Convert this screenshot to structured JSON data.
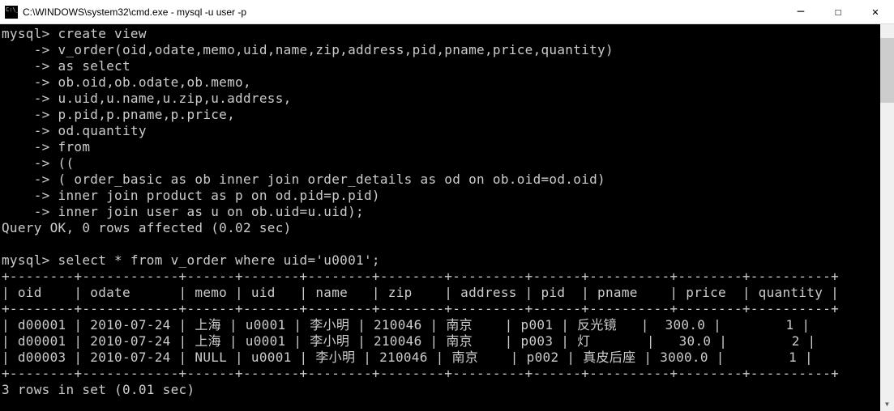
{
  "window": {
    "title": "C:\\WINDOWS\\system32\\cmd.exe - mysql  -u user -p"
  },
  "terminal": {
    "lines": [
      "mysql> create view",
      "    -> v_order(oid,odate,memo,uid,name,zip,address,pid,pname,price,quantity)",
      "    -> as select",
      "    -> ob.oid,ob.odate,ob.memo,",
      "    -> u.uid,u.name,u.zip,u.address,",
      "    -> p.pid,p.pname,p.price,",
      "    -> od.quantity",
      "    -> from",
      "    -> ((",
      "    -> ( order_basic as ob inner join order_details as od on ob.oid=od.oid)",
      "    -> inner join product as p on od.pid=p.pid)",
      "    -> inner join user as u on ob.uid=u.uid);",
      "Query OK, 0 rows affected (0.02 sec)",
      "",
      "mysql> select * from v_order where uid='u0001';",
      "+--------+------------+------+-------+--------+--------+---------+------+----------+--------+----------+",
      "| oid    | odate      | memo | uid   | name   | zip    | address | pid  | pname    | price  | quantity |",
      "+--------+------------+------+-------+--------+--------+---------+------+----------+--------+----------+",
      "| d00001 | 2010-07-24 | 上海 | u0001 | 李小明 | 210046 | 南京    | p001 | 反光镜   |  300.0 |        1 |",
      "| d00001 | 2010-07-24 | 上海 | u0001 | 李小明 | 210046 | 南京    | p003 | 灯       |   30.0 |        2 |",
      "| d00003 | 2010-07-24 | NULL | u0001 | 李小明 | 210046 | 南京    | p002 | 真皮后座 | 3000.0 |        1 |",
      "+--------+------------+------+-------+--------+--------+---------+------+----------+--------+----------+",
      "3 rows in set (0.01 sec)"
    ]
  },
  "chart_data": {
    "type": "table",
    "title": "select * from v_order where uid='u0001'",
    "columns": [
      "oid",
      "odate",
      "memo",
      "uid",
      "name",
      "zip",
      "address",
      "pid",
      "pname",
      "price",
      "quantity"
    ],
    "rows": [
      [
        "d00001",
        "2010-07-24",
        "上海",
        "u0001",
        "李小明",
        "210046",
        "南京",
        "p001",
        "反光镜",
        300.0,
        1
      ],
      [
        "d00001",
        "2010-07-24",
        "上海",
        "u0001",
        "李小明",
        "210046",
        "南京",
        "p003",
        "灯",
        30.0,
        2
      ],
      [
        "d00003",
        "2010-07-24",
        "NULL",
        "u0001",
        "李小明",
        "210046",
        "南京",
        "p002",
        "真皮后座",
        3000.0,
        1
      ]
    ],
    "footer": "3 rows in set (0.01 sec)"
  }
}
